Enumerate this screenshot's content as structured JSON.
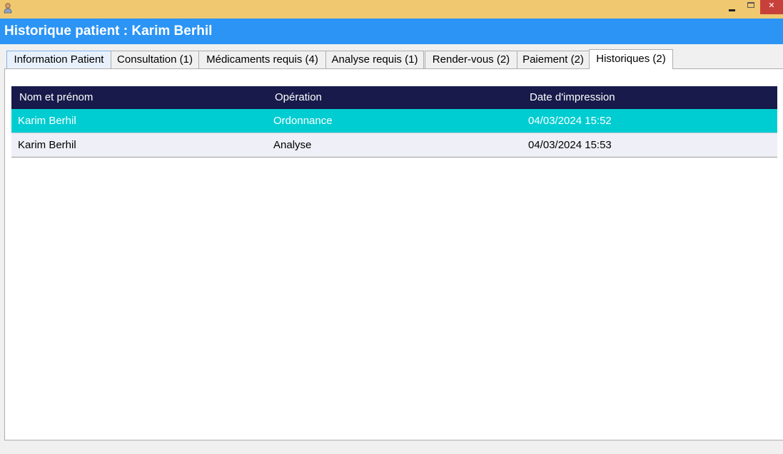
{
  "window": {
    "close_glyph": "✕"
  },
  "header": {
    "title": "Historique patient : Karim Berhil"
  },
  "tabs": [
    {
      "label": "Information Patient"
    },
    {
      "label": "Consultation (1)"
    },
    {
      "label": "Médicaments requis (4)"
    },
    {
      "label": "Analyse requis (1)"
    },
    {
      "label": "Render-vous (2)"
    },
    {
      "label": "Paiement (2)"
    },
    {
      "label": "Historiques (2)",
      "active": true
    }
  ],
  "table": {
    "columns": [
      "Nom et prénom",
      "Opération",
      "Date d'impression"
    ],
    "rows": [
      {
        "name": "Karim Berhil",
        "operation": "Ordonnance",
        "date": "04/03/2024 15:52",
        "selected": true
      },
      {
        "name": "Karim Berhil",
        "operation": "Analyse",
        "date": "04/03/2024 15:53",
        "selected": false
      }
    ]
  },
  "colors": {
    "titlebar": "#f0c870",
    "header": "#2b94f5",
    "table_header": "#171a4a",
    "selected_row": "#00cdd1",
    "row": "#efeff7",
    "close_button": "#c7403a"
  },
  "icons": {
    "app": "user-icon",
    "minimize": "minimize-icon",
    "maximize": "maximize-icon",
    "close": "close-icon"
  }
}
